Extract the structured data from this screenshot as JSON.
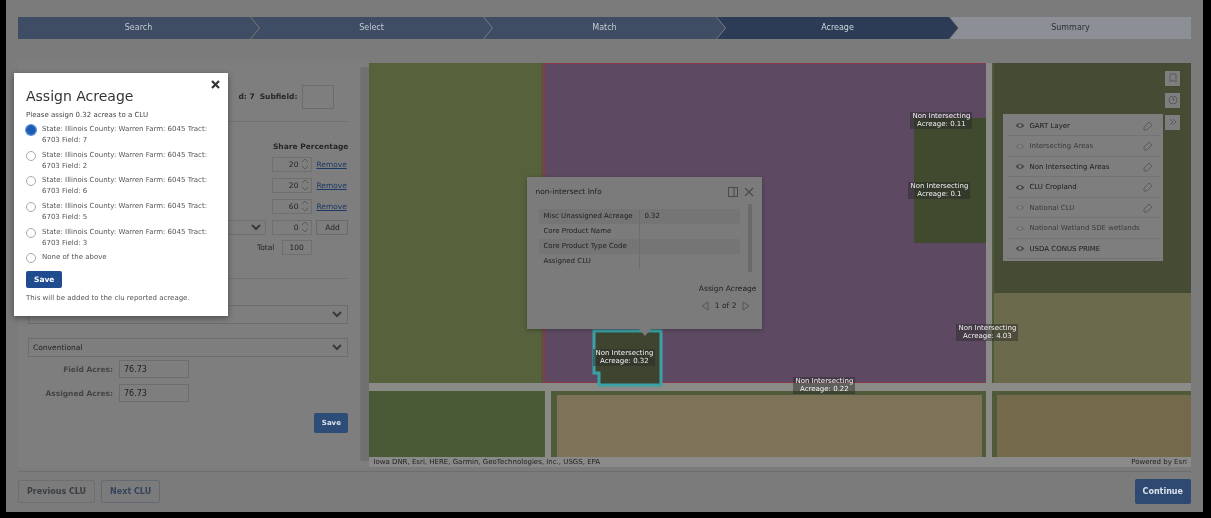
{
  "steps": [
    {
      "label": "Search",
      "selected": false,
      "disabled": false
    },
    {
      "label": "Select",
      "selected": false,
      "disabled": false
    },
    {
      "label": "Match",
      "selected": false,
      "disabled": false
    },
    {
      "label": "Acreage",
      "selected": true,
      "disabled": false
    },
    {
      "label": "Summary",
      "selected": false,
      "disabled": true
    }
  ],
  "field_panel": {
    "field_fragment": "d: 7",
    "subfield_label": "Subfield:",
    "share_header": "Share Percentage",
    "shares": [
      {
        "value": "20",
        "action": "Remove"
      },
      {
        "value": "20",
        "action": "Remove"
      },
      {
        "value": "60",
        "action": "Remove"
      }
    ],
    "new_share": {
      "value": "0",
      "action": "Add"
    },
    "total_label": "Total",
    "total_value": "100",
    "practice": "Conventional",
    "acres": [
      {
        "label": "Field Acres:",
        "value": "76.73"
      },
      {
        "label": "Assigned Acres:",
        "value": "76.73"
      }
    ],
    "save": "Save"
  },
  "map": {
    "labels": [
      {
        "line1": "Non Intersecting",
        "line2": "Acreage: 0.11"
      },
      {
        "line1": "Non Intersecting",
        "line2": "Acreage: 0.1"
      },
      {
        "line1": "Non Intersecting",
        "line2": "Acreage: 0.32"
      },
      {
        "line1": "Non Intersecting",
        "line2": "Acreage: 0.22"
      },
      {
        "line1": "Non Intersecting",
        "line2": "Acreage: 4.03"
      }
    ],
    "popup": {
      "title": "non-intersect Info",
      "rows": [
        {
          "name": "Misc Unassigned Acreage",
          "value": "0.32"
        },
        {
          "name": "Core Product Name"
        },
        {
          "name": "Core Product Type Code"
        },
        {
          "name": "Assigned CLU"
        }
      ],
      "action": "Assign Acreage",
      "pager": "1 of 2"
    },
    "layers": [
      {
        "name": "GART Layer",
        "visible": true,
        "editable": true
      },
      {
        "name": "Intersecting Areas",
        "visible": false,
        "editable": true
      },
      {
        "name": "Non Intersecting Areas",
        "visible": true,
        "editable": true
      },
      {
        "name": "CLU Cropland",
        "visible": true,
        "editable": true
      },
      {
        "name": "National CLU",
        "visible": false,
        "editable": true
      },
      {
        "name": "National Wetland SDE wetlands",
        "visible": false,
        "editable": false
      },
      {
        "name": "USDA CONUS PRIME",
        "visible": true,
        "editable": false
      }
    ],
    "attribution": "Iowa DNR, Esri, HERE, Garmin, GeoTechnologies, Inc., USGS, EPA",
    "powered_by": "Powered by Esri"
  },
  "modal": {
    "title": "Assign Acreage",
    "message": "Please assign 0.32 acreas to a CLU",
    "options": [
      {
        "label": "State: Illinois County: Warren Farm: 6045 Tract: 6703 Field: 7",
        "selected": true
      },
      {
        "label": "State: Illinois County: Warren Farm: 6045 Tract: 6703 Field: 2",
        "selected": false
      },
      {
        "label": "State: Illinois County: Warren Farm: 6045 Tract: 6703 Field: 6",
        "selected": false
      },
      {
        "label": "State: Illinois County: Warren Farm: 6045 Tract: 6703 Field: 5",
        "selected": false
      },
      {
        "label": "State: Illinois County: Warren Farm: 6045 Tract: 6703 Field: 3",
        "selected": false
      },
      {
        "label": "None of the above",
        "selected": false
      }
    ],
    "save": "Save",
    "note": "This will be added to the clu reported acreage."
  },
  "footer": {
    "buttons": [
      {
        "label": "Previous CLU",
        "disabled": true
      },
      {
        "label": "Next CLU",
        "disabled": false
      }
    ],
    "continue": "Continue"
  }
}
